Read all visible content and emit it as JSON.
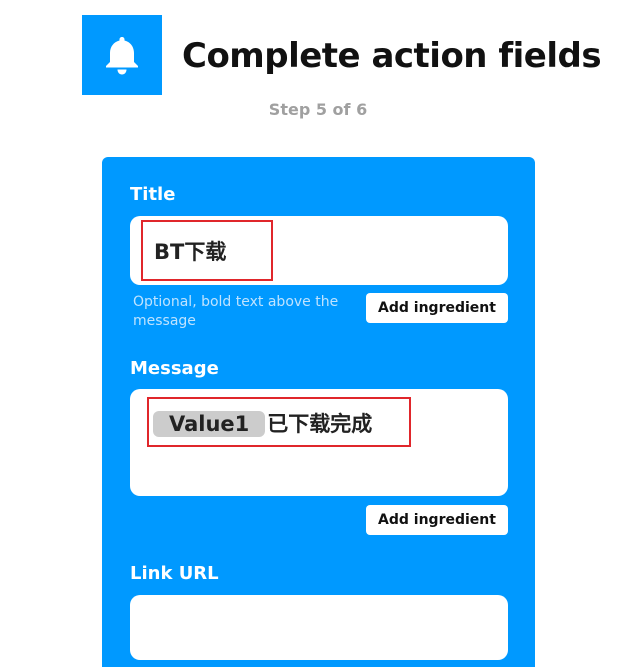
{
  "header": {
    "icon": "bell-icon",
    "title": "Complete action fields",
    "step": "Step 5 of 6"
  },
  "colors": {
    "accent": "#0099ff",
    "highlight": "#e0262b"
  },
  "form": {
    "title": {
      "label": "Title",
      "value": "BT下载",
      "helper": "Optional, bold text above the message",
      "button": "Add ingredient"
    },
    "message": {
      "label": "Message",
      "ingredient": "Value1",
      "value": "已下载完成",
      "button": "Add ingredient"
    },
    "link_url": {
      "label": "Link URL",
      "value": ""
    }
  }
}
